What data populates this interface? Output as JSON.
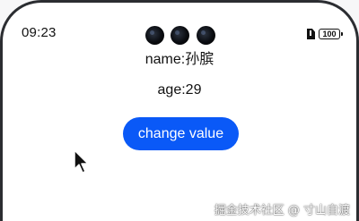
{
  "status_bar": {
    "time": "09:23",
    "battery_level": "100",
    "sim_icon": "sim-card-icon"
  },
  "content": {
    "name_line": "name:孙膑",
    "age_line": "age:29",
    "button_label": "change value"
  },
  "colors": {
    "accent": "#0a59f7",
    "text": "#111111",
    "background": "#ffffff",
    "bezel": "#2b2d31"
  },
  "watermark": "掘金技术社区 @ 寸山自渡"
}
